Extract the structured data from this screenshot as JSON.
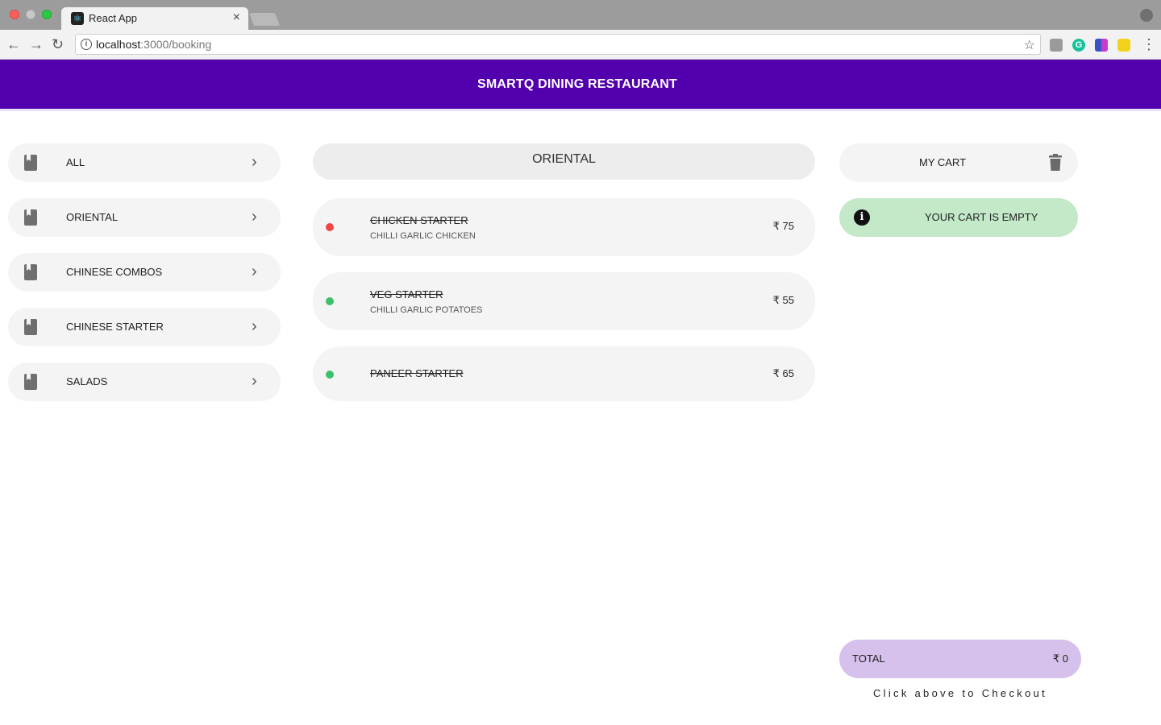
{
  "browser": {
    "tab_title": "React App",
    "tab_close": "×",
    "url_host": "localhost",
    "url_path": ":3000/booking",
    "icons": [
      "react-favicon",
      "close-icon",
      "back-arrow-icon",
      "forward-arrow-icon",
      "reload-icon",
      "info-icon",
      "star-icon",
      "profile-icon",
      "more-vert-icon"
    ]
  },
  "header": {
    "title": "SMARTQ DINING RESTAURANT",
    "color": "#5200ad"
  },
  "categories": [
    {
      "label": "ALL"
    },
    {
      "label": "ORIENTAL"
    },
    {
      "label": "CHINESE COMBOS"
    },
    {
      "label": "CHINESE STARTER"
    },
    {
      "label": "SALADS"
    }
  ],
  "menu": {
    "section_title": "ORIENTAL",
    "items": [
      {
        "name": "CHICKEN STARTER",
        "description": "CHILLI GARLIC CHICKEN",
        "price": "₹ 75",
        "veg": false,
        "dot_color": "#f04545"
      },
      {
        "name": "VEG STARTER",
        "description": "CHILLI GARLIC POTATOES",
        "price": "₹ 55",
        "veg": true,
        "dot_color": "#3cc06a"
      },
      {
        "name": "PANEER STARTER",
        "description": "",
        "price": "₹ 65",
        "veg": true,
        "dot_color": "#3cc06a"
      }
    ]
  },
  "cart": {
    "title": "MY CART",
    "empty_message": "YOUR CART IS EMPTY",
    "info_glyph": "i",
    "total_label": "TOTAL",
    "total_value": "₹ 0",
    "checkout_hint": "Click above to Checkout",
    "empty_color": "#c3e9c9",
    "total_color": "#d6c1ec"
  }
}
